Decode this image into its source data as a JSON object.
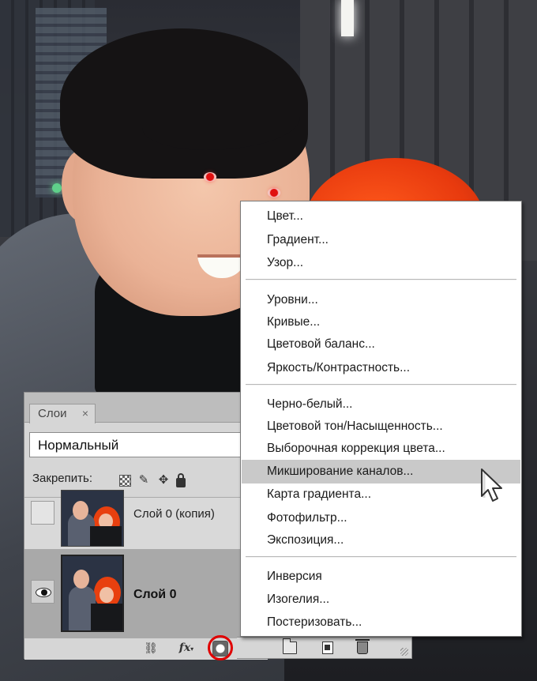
{
  "layers_panel": {
    "tab_label": "Слои",
    "tab_close": "×",
    "blend_mode": "Нормальный",
    "lock_label": "Закрепить:",
    "layers": [
      {
        "name": "Слой 0 (копия)",
        "visible": false,
        "selected": false
      },
      {
        "name": "Слой 0",
        "visible": true,
        "selected": true
      }
    ],
    "footer": {
      "fx_label": "fx"
    },
    "highlighted_button": "add-adjustment-layer-button"
  },
  "adjustment_menu": {
    "groups": [
      [
        "Цвет...",
        "Градиент...",
        "Узор..."
      ],
      [
        "Уровни...",
        "Кривые...",
        "Цветовой баланс...",
        "Яркость/Контрастность..."
      ],
      [
        "Черно-белый...",
        "Цветовой тон/Насыщенность...",
        "Выборочная коррекция цвета...",
        "Микширование каналов...",
        "Карта градиента...",
        "Фотофильтр...",
        "Экспозиция..."
      ],
      [
        "Инверсия",
        "Изогелия...",
        "Постеризовать..."
      ]
    ],
    "highlighted_item": "Микширование каналов..."
  },
  "colors": {
    "menu_highlight": "#c9c9c9",
    "annotation_circle": "#e00000",
    "panel_bg": "#d6d6d6"
  }
}
